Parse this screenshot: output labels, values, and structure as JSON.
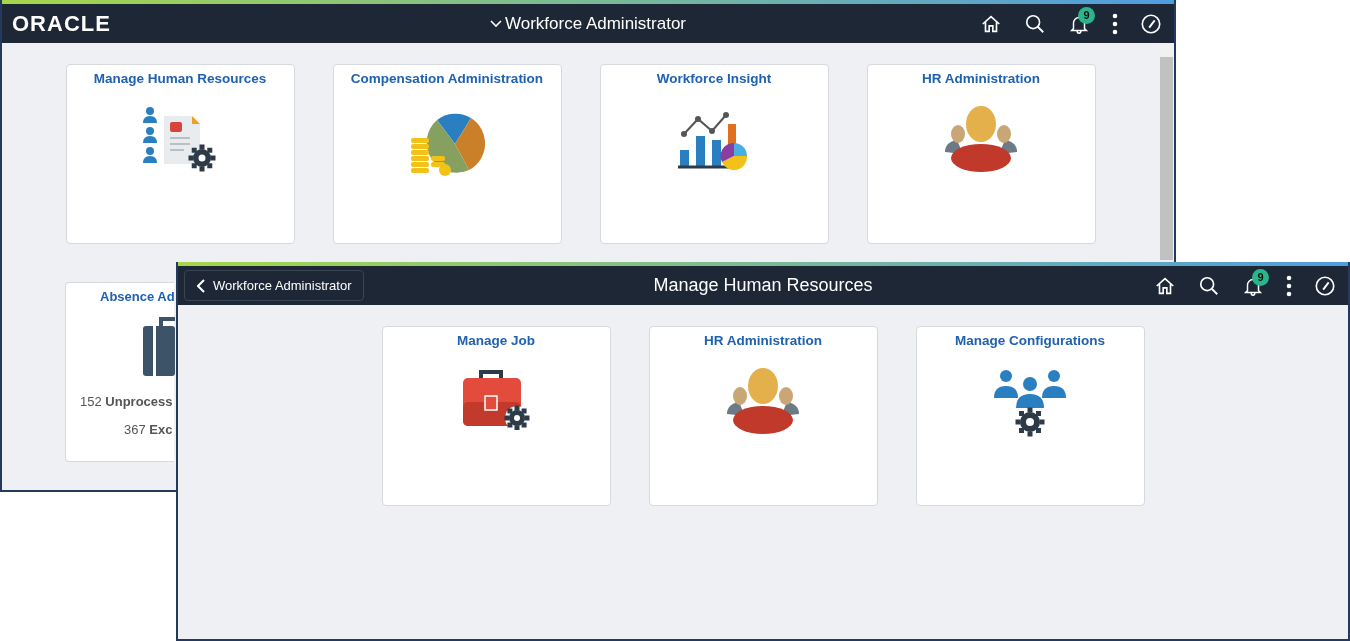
{
  "back_window": {
    "logo": "ORACLE",
    "title": "Workforce Administrator",
    "notification_count": "9",
    "tiles": [
      {
        "title": "Manage Human Resources",
        "kind": "people-doc"
      },
      {
        "title": "Compensation Administration",
        "kind": "pie-coins"
      },
      {
        "title": "Workforce Insight",
        "kind": "charts"
      },
      {
        "title": "HR Administration",
        "kind": "people"
      }
    ],
    "partial_tile": {
      "title": "Absence Ad",
      "kind": "suitcase",
      "lines": [
        "152 **Unprocess**",
        "367 **Exc**"
      ]
    }
  },
  "front_window": {
    "back_button": "Workforce Administrator",
    "title": "Manage Human Resources",
    "notification_count": "9",
    "tiles": [
      {
        "title": "Manage Job",
        "kind": "briefcase-gear"
      },
      {
        "title": "HR Administration",
        "kind": "people"
      },
      {
        "title": "Manage Configurations",
        "kind": "team-gear"
      }
    ]
  }
}
